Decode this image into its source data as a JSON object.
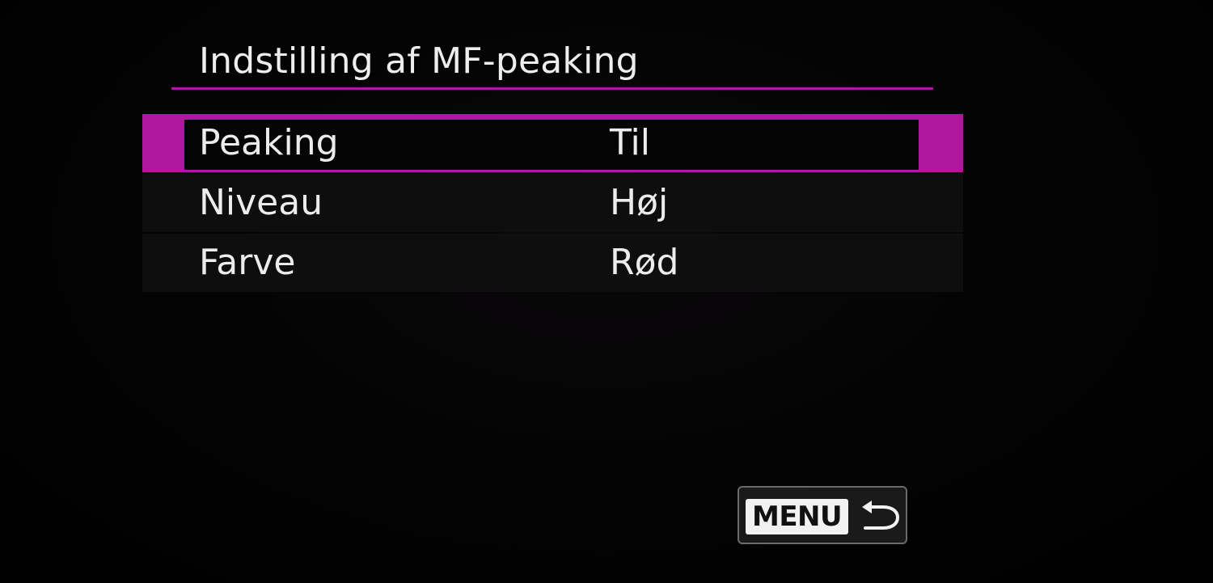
{
  "screen": {
    "title": "Indstilling af MF-peaking",
    "accent_color": "#b0179f"
  },
  "menu": {
    "items": [
      {
        "label": "Peaking",
        "value": "Til",
        "selected": true
      },
      {
        "label": "Niveau",
        "value": "Høj",
        "selected": false
      },
      {
        "label": "Farve",
        "value": "Rød",
        "selected": false
      }
    ]
  },
  "footer": {
    "menu_button_label": "MENU",
    "menu_button_icon": "return-arrow-icon"
  }
}
